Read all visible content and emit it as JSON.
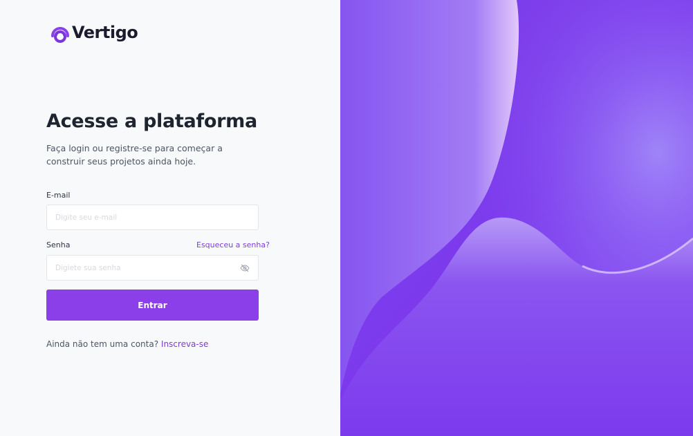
{
  "brand": {
    "name": "Vertigo",
    "accent": "#8a3fe8"
  },
  "login": {
    "title": "Acesse a plataforma",
    "subtitle": "Faça login ou registre-se para começar a construir seus projetos ainda hoje.",
    "email_label": "E-mail",
    "email_placeholder": "Digite seu e-mail",
    "password_label": "Senha",
    "forgot_link": "Esqueceu a senha?",
    "password_placeholder": "Digiete sua senha",
    "password_toggle_icon": "eye-off-icon",
    "submit_label": "Entrar",
    "signup_prompt": "Ainda não tem uma conta?",
    "signup_link": "Inscreva-se"
  }
}
